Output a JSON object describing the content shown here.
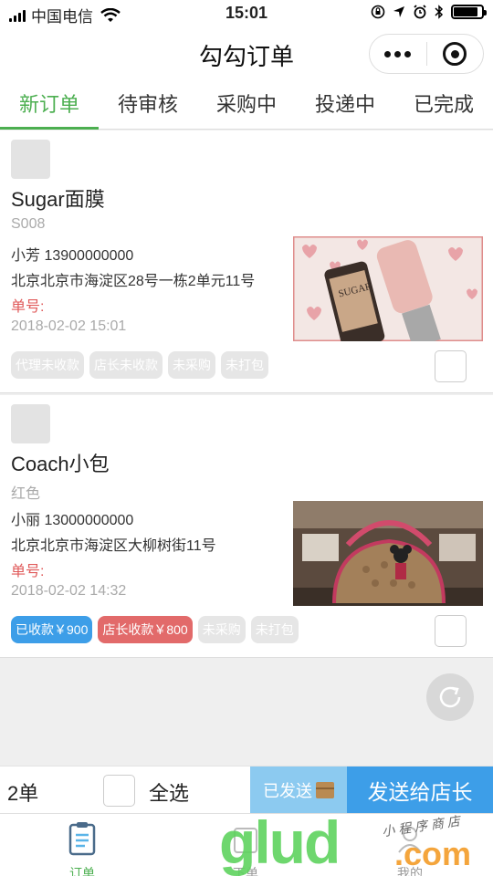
{
  "status_bar": {
    "carrier": "中国电信",
    "time": "15:01"
  },
  "nav": {
    "title": "勾勾订单"
  },
  "tabs": [
    {
      "label": "新订单",
      "active": true
    },
    {
      "label": "待审核",
      "active": false
    },
    {
      "label": "采购中",
      "active": false
    },
    {
      "label": "投递中",
      "active": false
    },
    {
      "label": "已完成",
      "active": false
    }
  ],
  "orders": [
    {
      "title": "Sugar面膜",
      "spec": "S008",
      "contact": "小芳 13900000000",
      "address": "北京北京市海淀区28号一栋2单元11号",
      "number_label": "单号:",
      "time": "2018-02-02 15:01",
      "badges": [
        "代理未收款",
        "店长未收款",
        "未采购",
        "未打包"
      ]
    },
    {
      "title": "Coach小包",
      "spec": "红色",
      "contact": "小丽 13000000000",
      "address": "北京北京市海淀区大柳树街11号",
      "number_label": "单号:",
      "time": "2018-02-02 14:32",
      "badges": [
        "已收款￥900",
        "店长收款￥800",
        "未采购",
        "未打包"
      ]
    }
  ],
  "action_bar": {
    "count": "2单",
    "select_all": "全选",
    "sent_label": "已发送",
    "send_label": "发送给店长"
  },
  "tab_bar": [
    {
      "label": "订单",
      "icon": "order-list-icon"
    },
    {
      "label": "下单",
      "icon": "place-order-icon"
    },
    {
      "label": "我的",
      "icon": "profile-icon"
    }
  ],
  "watermark": {
    "brand": "glud",
    "domain": ".com",
    "tagline": "小程序商店"
  },
  "colors": {
    "accent_green": "#4caf50",
    "blue": "#3d9ee8",
    "light_blue": "#8ccaf0",
    "red": "#e26a6a"
  }
}
